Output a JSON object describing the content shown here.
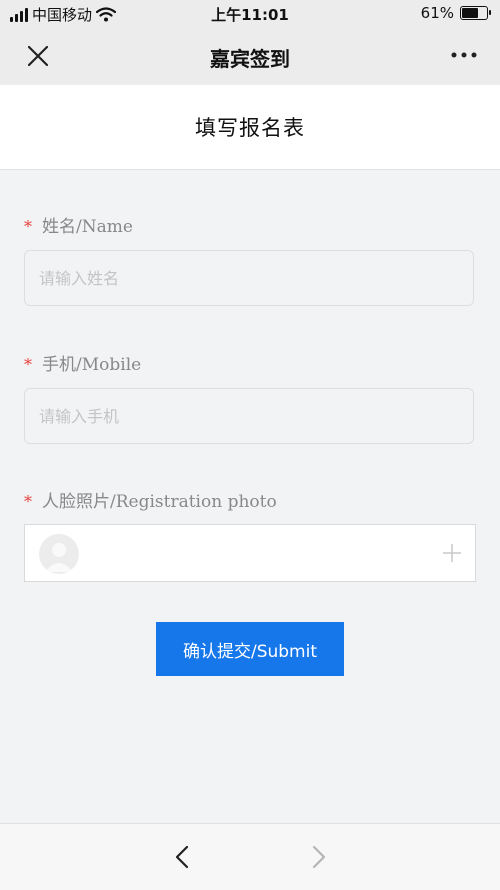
{
  "status_bar": {
    "carrier": "中国移动",
    "time": "上午11:01",
    "battery_text": "61%",
    "battery_level": 0.61
  },
  "nav": {
    "title": "嘉宾签到",
    "close_icon": "close-icon",
    "more_icon": "more-icon"
  },
  "page": {
    "title": "填写报名表"
  },
  "form": {
    "required_mark": "*",
    "name_label": "姓名/Name",
    "name_placeholder": "请输入姓名",
    "mobile_label": "手机/Mobile",
    "mobile_placeholder": "请输入手机",
    "photo_label": "人脸照片/Registration photo",
    "submit_label": "确认提交/Submit"
  },
  "colors": {
    "accent": "#1677ea",
    "required": "#e5413d",
    "background": "#f2f3f5"
  },
  "bottom_bar": {
    "back_icon": "chevron-left-icon",
    "forward_icon": "chevron-right-icon"
  }
}
